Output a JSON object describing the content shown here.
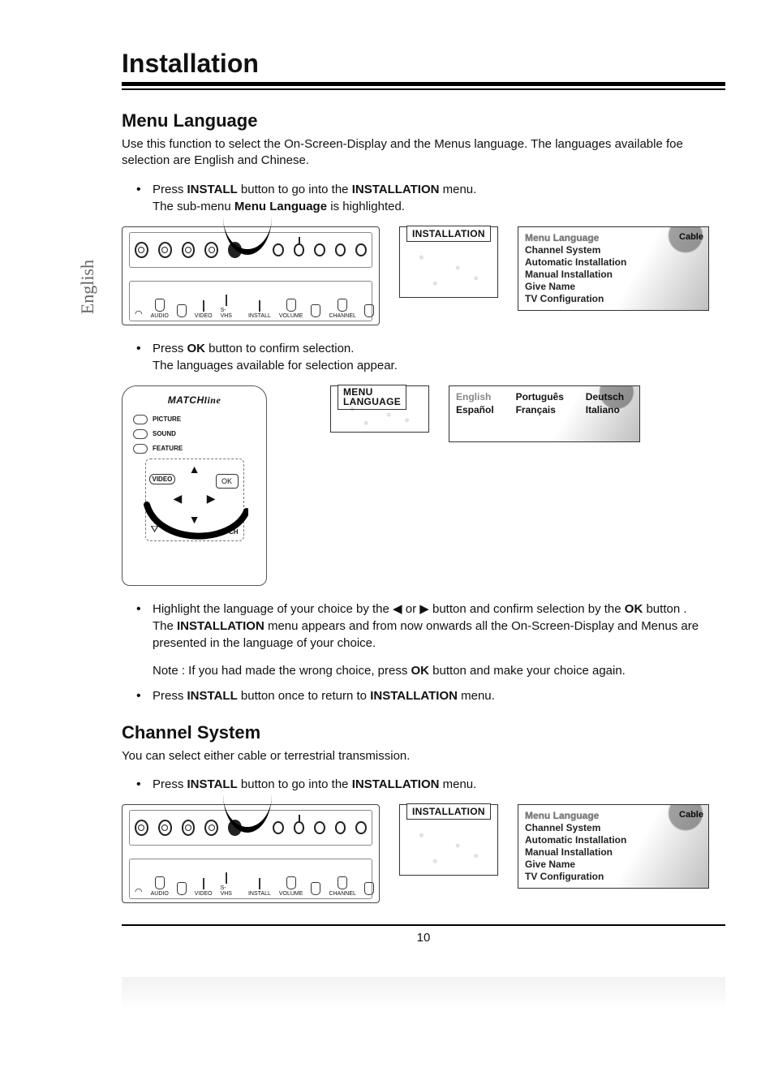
{
  "sideTab": "English",
  "title": "Installation",
  "menuLang": {
    "heading": "Menu Language",
    "intro": "Use this function to select the On-Screen-Display and the Menus language. The languages available foe selection are English and Chinese.",
    "step1": {
      "t1": "Press ",
      "b1": "INSTALL",
      "t2": " button to go into the ",
      "b2": "INSTALLATION",
      "t3": " menu.",
      "t4": "The sub-menu ",
      "b3": "Menu Language",
      "t5": " is highlighted."
    },
    "step2": {
      "t1": "Press ",
      "b1": "OK",
      "t2": " button to confirm selection.",
      "t3": "The languages available for selection appear."
    },
    "step3": {
      "t1": "Highlight the language of your choice by the ",
      "arrL": "◀",
      "t2": " or ",
      "arrR": "▶",
      "t3": " button and confirm selection by the ",
      "b1": "OK",
      "t4": " button .",
      "t5": "The ",
      "b2": "INSTALLATION",
      "t6": " menu appears and from now onwards all the On-Screen-Display and Menus are presented in the language of your choice."
    },
    "note": {
      "t1": "Note : If you had made the wrong choice, press ",
      "b1": "OK",
      "t2": " button and make your choice again."
    },
    "step4": {
      "t1": "Press ",
      "b1": "INSTALL",
      "t2": " button once to return to ",
      "b2": "INSTALLATION",
      "t3": " menu."
    }
  },
  "chanSys": {
    "heading": "Channel System",
    "intro": "You can select either cable or terrestrial transmission.",
    "step1": {
      "t1": "Press ",
      "b1": "INSTALL",
      "t2": " button to go into the ",
      "b2": "INSTALLATION",
      "t3": " menu."
    }
  },
  "tvButtons": {
    "audio": "AUDIO",
    "video": "VIDEO",
    "svhs": "S-VHS",
    "install": "INSTALL",
    "volume": "VOLUME",
    "channel": "CHANNEL"
  },
  "osd": {
    "install": "INSTALLATION",
    "menuLang1": "MENU",
    "menuLang2": "LANGUAGE"
  },
  "installMenu": {
    "items": [
      "Menu Language",
      "Channel System",
      "Automatic Installation",
      "Manual Installation",
      "Give Name",
      "TV Configuration"
    ],
    "right": "Cable"
  },
  "installMenu2": {
    "items": [
      "Menu Language",
      "Channel System",
      "Automatic Installation",
      "Manual Installation",
      "Give Name",
      "TV Configuration"
    ],
    "right": "Cable"
  },
  "langMenu": {
    "langs": [
      "English",
      "Português",
      "Deutsch",
      "Español",
      "Français",
      "Italiano"
    ]
  },
  "remote": {
    "brand1": "MATCH",
    "brand2": "LINE",
    "picture": "PICTURE",
    "sound": "SOUND",
    "feature": "FEATURE",
    "video": "VIDEO",
    "ok": "OK",
    "ch": "CH"
  },
  "pageNum": "10"
}
